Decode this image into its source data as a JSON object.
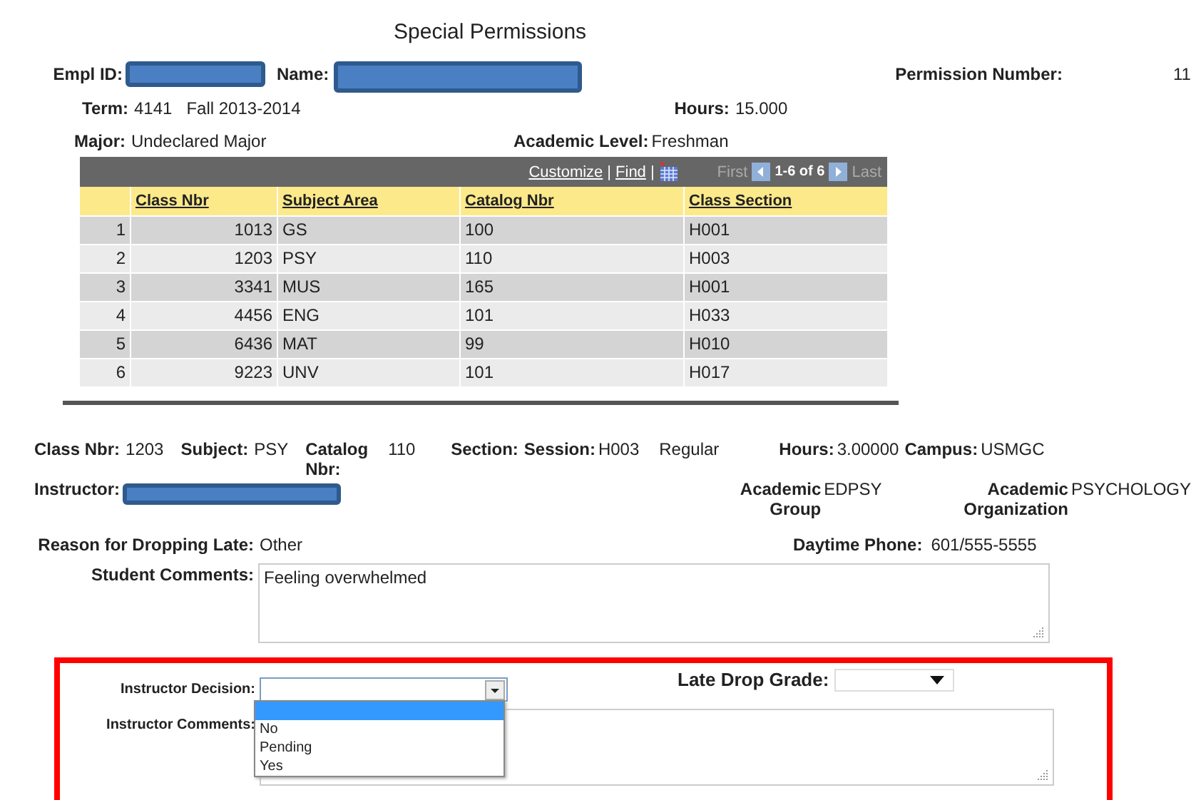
{
  "title": "Special Permissions",
  "empl_id": {
    "label": "Empl ID:"
  },
  "name": {
    "label": "Name:"
  },
  "permission_number": {
    "label": "Permission Number:",
    "value": "11"
  },
  "term": {
    "label": "Term:",
    "code": "4141",
    "value": "Fall 2013-2014"
  },
  "hours": {
    "label": "Hours:",
    "value": "15.000"
  },
  "major": {
    "label": "Major:",
    "value": "Undeclared Major"
  },
  "academic_level": {
    "label": "Academic Level:",
    "value": "Freshman"
  },
  "grid": {
    "toolbar": [
      {
        "kind": "link",
        "text": "Customize"
      },
      {
        "kind": "sep",
        "text": "|"
      },
      {
        "kind": "link",
        "text": "Find"
      },
      {
        "kind": "sep",
        "text": "|"
      }
    ],
    "first": {
      "label": "First",
      "disabled": true
    },
    "range": "1-6 of 6",
    "last": {
      "label": "Last",
      "disabled": true
    },
    "columns": [
      "Class Nbr",
      "Subject Area",
      "Catalog Nbr",
      "Class Section"
    ],
    "rows": [
      {
        "row": "1",
        "class_nbr": "1013",
        "subject_area": "GS",
        "catalog_nbr": "100",
        "class_section": "H001"
      },
      {
        "row": "2",
        "class_nbr": "1203",
        "subject_area": "PSY",
        "catalog_nbr": "110",
        "class_section": "H003"
      },
      {
        "row": "3",
        "class_nbr": "3341",
        "subject_area": "MUS",
        "catalog_nbr": "165",
        "class_section": "H001"
      },
      {
        "row": "4",
        "class_nbr": "4456",
        "subject_area": "ENG",
        "catalog_nbr": "101",
        "class_section": "H033"
      },
      {
        "row": "5",
        "class_nbr": "6436",
        "subject_area": "MAT",
        "catalog_nbr": "99",
        "class_section": "H010"
      },
      {
        "row": "6",
        "class_nbr": "9223",
        "subject_area": "UNV",
        "catalog_nbr": "101",
        "class_section": "H017"
      }
    ]
  },
  "class_fields": [
    {
      "label": "Class Nbr:",
      "value": "1203"
    },
    {
      "label": "Subject:",
      "value": "PSY"
    },
    {
      "label": "Catalog Nbr:",
      "value": "110"
    },
    {
      "label": "Section:"
    },
    {
      "label": "Session:",
      "value": "H003"
    },
    {
      "value": "Regular"
    },
    {
      "label": "Hours:",
      "value": "3.00000"
    },
    {
      "label": "Campus:",
      "value": "USMGC"
    }
  ],
  "instructor": {
    "label": "Instructor:"
  },
  "academic_group": {
    "label": "Academic Group",
    "value": "EDPSY"
  },
  "academic_organization": {
    "label": "Academic Organization",
    "value": "PSYCHOLOGY"
  },
  "reason": {
    "label": "Reason for Dropping Late:",
    "value": "Other"
  },
  "daytime_phone": {
    "label": "Daytime Phone:",
    "value": "601/555-5555"
  },
  "student_comments": {
    "label": "Student Comments:",
    "value": "Feeling overwhelmed"
  },
  "instructor_decision": {
    "label": "Instructor Decision:",
    "expanded": true,
    "options": [
      {
        "selected": true
      },
      {
        "label": "No",
        "selected": false
      },
      {
        "label": "Pending",
        "selected": false
      },
      {
        "label": "Yes",
        "selected": false
      }
    ]
  },
  "late_drop_grade": {
    "label": "Late Drop Grade:"
  },
  "instructor_comments": {
    "label": "Instructor Comments:"
  }
}
